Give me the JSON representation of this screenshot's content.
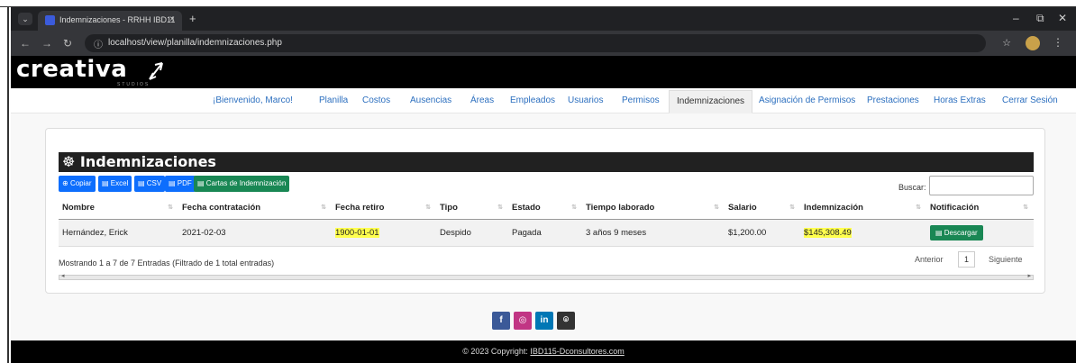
{
  "browser": {
    "tab_title": "Indemnizaciones - RRHH IBD11",
    "url": "localhost/view/planilla/indemnizaciones.php"
  },
  "site": {
    "logo": "creativa",
    "logo_sub": "STUDIOS"
  },
  "nav": {
    "items": [
      {
        "label": "¡Bienvenido, Marco!"
      },
      {
        "label": "Planilla"
      },
      {
        "label": "Costos"
      },
      {
        "label": "Ausencias"
      },
      {
        "label": "Áreas"
      },
      {
        "label": "Empleados"
      },
      {
        "label": "Usuarios"
      },
      {
        "label": "Permisos"
      },
      {
        "label": "Indemnizaciones"
      },
      {
        "label": "Asignación de Permisos"
      },
      {
        "label": "Prestaciones"
      },
      {
        "label": "Horas Extras"
      },
      {
        "label": "Cerrar Sesión"
      }
    ]
  },
  "page": {
    "title": "Indemnizaciones",
    "buttons": {
      "copy": "Copiar",
      "excel": "Excel",
      "csv": "CSV",
      "pdf": "PDF",
      "cartas": "Cartas de Indemnización"
    },
    "search_label": "Buscar:",
    "search_value": ""
  },
  "table": {
    "headers": [
      "Nombre",
      "Fecha contratación",
      "Fecha retiro",
      "Tipo",
      "Estado",
      "Tiempo laborado",
      "Salario",
      "Indemnización",
      "Notificación"
    ],
    "rows": [
      {
        "nombre": "Hernández, Erick",
        "fecha_contratacion": "2021-02-03",
        "fecha_retiro": "1900-01-01",
        "tipo": "Despido",
        "estado": "Pagada",
        "tiempo": "3 años 9 meses",
        "salario": "$1,200.00",
        "indemnizacion": "$145,308.49",
        "notificacion": "Descargar"
      }
    ]
  },
  "footer_info": {
    "showing": "Mostrando 1 a 7 de 7 Entradas (Filtrado de 1 total entradas)",
    "prev": "Anterior",
    "page": "1",
    "next": "Siguiente"
  },
  "social": [
    "f",
    "◎",
    "in",
    "⌾"
  ],
  "footer": {
    "copyright": "© 2023 Copyright: ",
    "link": "IBD115-Dconsultores.com"
  }
}
